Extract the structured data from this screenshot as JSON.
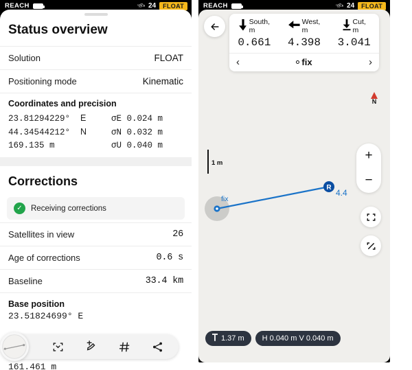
{
  "statusbar": {
    "device": "REACH",
    "battery_icon": "battery-icon",
    "satellite_icon": "satellite-icon",
    "satellite_count": "24",
    "solution_badge": "FLOAT"
  },
  "left": {
    "title": "Status overview",
    "rows": [
      {
        "label": "Solution",
        "value": "FLOAT"
      },
      {
        "label": "Positioning mode",
        "value": "Kinematic"
      }
    ],
    "coordinates": {
      "heading": "Coordinates and precision",
      "lines": [
        {
          "left": "23.81294229°",
          "left_unit": "E",
          "right": "σE 0.024 m"
        },
        {
          "left": "44.34544212°",
          "left_unit": "N",
          "right": "σN 0.032 m"
        },
        {
          "left": "169.135 m",
          "left_unit": "",
          "right": "σU 0.040 m"
        }
      ]
    },
    "corrections": {
      "title": "Corrections",
      "banner_text": "Receiving corrections",
      "banner_icon": "check-circle-icon",
      "rows": [
        {
          "label": "Satellites in view",
          "value": "26"
        },
        {
          "label": "Age of corrections",
          "value": "0.6 s"
        },
        {
          "label": "Baseline",
          "value": "33.4 km"
        }
      ]
    },
    "base_position": {
      "heading": "Base position",
      "lines": [
        {
          "text": "23.51824699°  E"
        },
        {
          "text": "161.461 m"
        }
      ]
    },
    "toolbar": {
      "items": [
        {
          "icon": "compass-dial-icon",
          "glyph": ""
        },
        {
          "icon": "fit-points-icon",
          "glyph": "⬚"
        },
        {
          "icon": "add-point-icon",
          "glyph": ""
        },
        {
          "icon": "grid-icon",
          "glyph": "#"
        },
        {
          "icon": "share-icon",
          "glyph": ""
        }
      ]
    }
  },
  "right": {
    "back_icon": "back-arrow-icon",
    "nav_card": {
      "cells": [
        {
          "arrow_icon": "arrow-down-icon",
          "arrow_glyph": "⬇",
          "label": "South,\nm",
          "label_line1": "South,",
          "label_line2": "m",
          "value": "0.661"
        },
        {
          "arrow_icon": "arrow-left-icon",
          "arrow_glyph": "⬅",
          "label": "West,\nm",
          "label_line1": "West,",
          "label_line2": "m",
          "value": "4.398"
        },
        {
          "arrow_icon": "arrow-down-to-line-icon",
          "arrow_glyph": "⤓",
          "label": "Cut,\nm",
          "label_line1": "Cut,",
          "label_line2": "m",
          "value": "3.041"
        }
      ],
      "prev_icon": "chevron-left-icon",
      "prev_glyph": "‹",
      "point_name": "fix",
      "next_icon": "chevron-right-icon",
      "next_glyph": "›"
    },
    "compass": {
      "icon": "north-arrow-icon",
      "label": "N"
    },
    "scale": {
      "label": "1 m"
    },
    "zoom": {
      "in_label": "+",
      "out_label": "−",
      "in_icon": "plus-icon",
      "out_icon": "minus-icon"
    },
    "map_buttons": [
      {
        "icon": "center-on-position-icon"
      },
      {
        "icon": "fit-to-extent-icon"
      }
    ],
    "map": {
      "current_point_label": "fix",
      "target_marker_label": "R",
      "distance_label": "4.4",
      "line_color": "#1a73c8",
      "marker_color": "#0b4ea2",
      "accuracy_circle_color": "#c9c9c7"
    },
    "pills": [
      {
        "icon": "antenna-height-icon",
        "icon_glyph": "♀",
        "text": "1.37 m"
      },
      {
        "text": "H 0.040 m   V 0.040 m"
      }
    ]
  }
}
